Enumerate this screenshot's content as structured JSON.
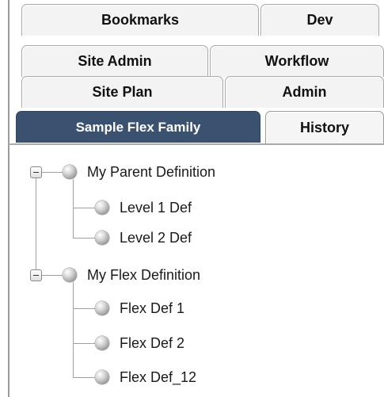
{
  "tabs": {
    "row1": [
      "Bookmarks",
      "Dev"
    ],
    "row2": [
      "Site Admin",
      "Workflow"
    ],
    "row3": [
      "Site Plan",
      "Admin"
    ],
    "row4": [
      "Sample Flex Family",
      "History"
    ],
    "active": "Sample Flex Family"
  },
  "tree": {
    "groups": [
      {
        "label": "My Parent Definition",
        "expanded": true,
        "children": [
          "Level 1 Def",
          "Level 2 Def"
        ]
      },
      {
        "label": "My Flex Definition",
        "expanded": true,
        "children": [
          "Flex Def 1",
          "Flex Def 2",
          "Flex Def_12"
        ]
      }
    ]
  }
}
